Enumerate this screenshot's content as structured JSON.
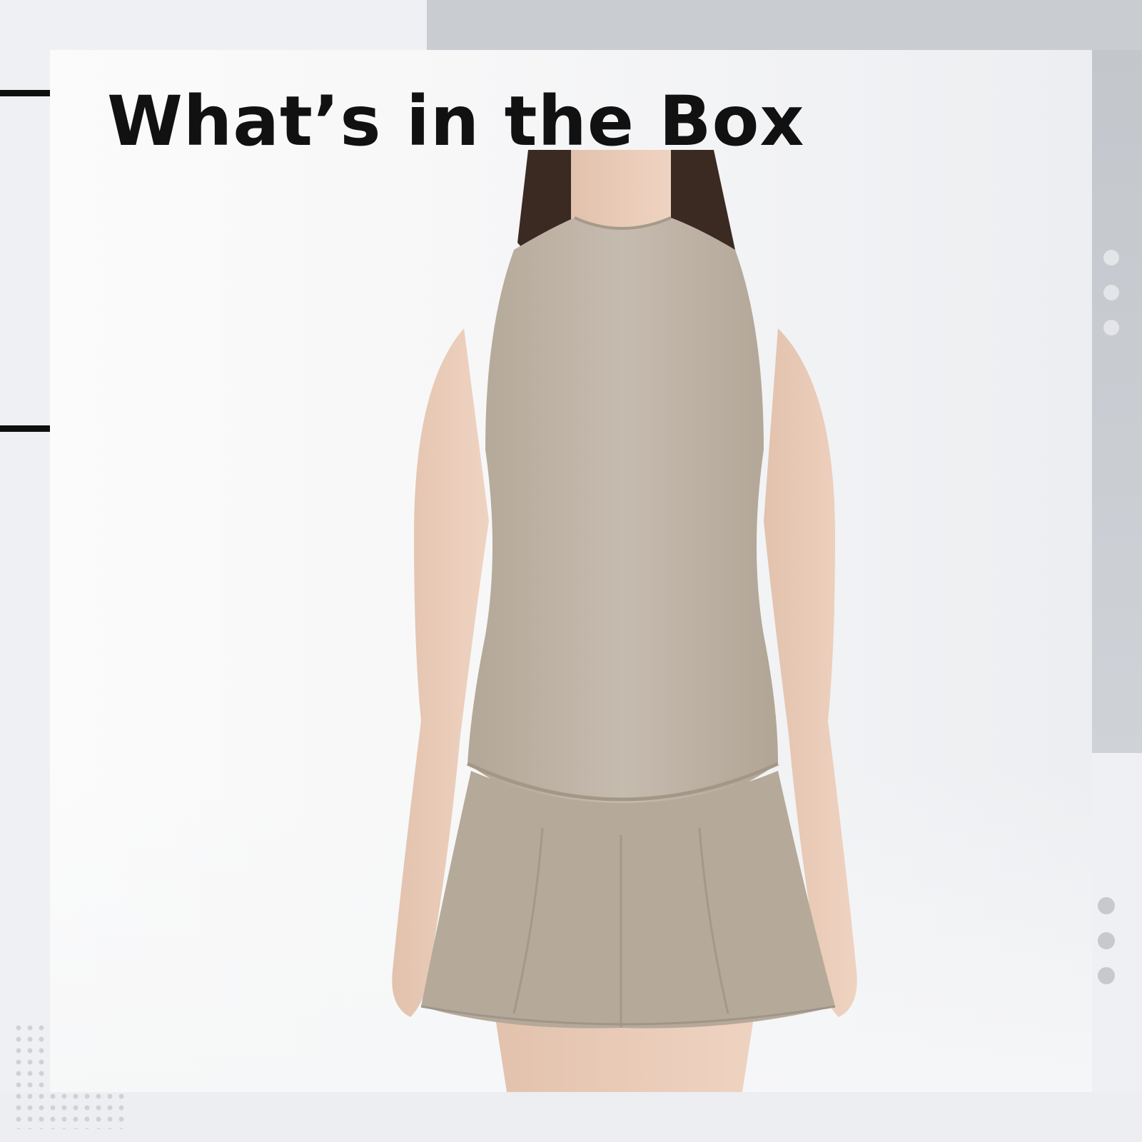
{
  "heading": "What’s in the Box",
  "product": {
    "color": "#c2b7aa"
  },
  "colors": {
    "accent_band": "#c9ccd1",
    "tick": "#0f0f0f",
    "dots": "#c7c9cd"
  }
}
